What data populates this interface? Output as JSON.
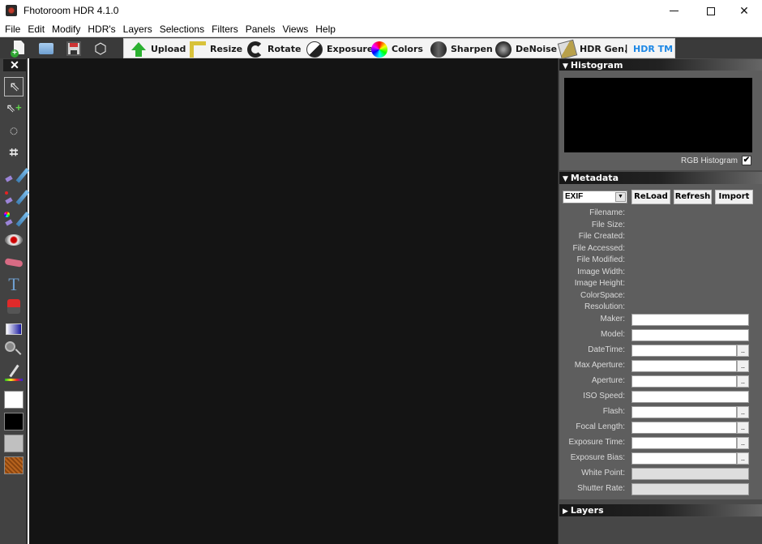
{
  "window": {
    "title": "Fhotoroom HDR 4.1.0",
    "controls": {
      "minimize": "–",
      "maximize": "☐",
      "close": "✕"
    }
  },
  "menu": {
    "items": [
      "File",
      "Edit",
      "Modify",
      "HDR's",
      "Layers",
      "Selections",
      "Filters",
      "Panels",
      "Views",
      "Help"
    ]
  },
  "toolbar": {
    "file_icons": [
      "new-file-icon",
      "open-folder-icon",
      "save-disk-icon",
      "3d-cube-icon"
    ],
    "actions": [
      {
        "label": "Upload",
        "icon": "upload-arrow-icon"
      },
      {
        "label": "Resize",
        "icon": "ruler-icon"
      },
      {
        "label": "Rotate",
        "icon": "rotate-icon"
      },
      {
        "label": "Exposure",
        "icon": "exposure-icon"
      },
      {
        "label": "Colors",
        "icon": "color-wheel-icon"
      },
      {
        "label": "Sharpen",
        "icon": "sharpen-icon"
      },
      {
        "label": "DeNoise",
        "icon": "denoise-icon"
      },
      {
        "label": "HDR Gen.",
        "icon": "hdr-gen-icon"
      }
    ],
    "separator": "|",
    "hdr_tm": "HDR TM",
    "hdr_tm_color": "#1e88e5"
  },
  "tools": {
    "close": "✕",
    "items": [
      {
        "name": "select-arrow",
        "glyph": "⇖",
        "active": true
      },
      {
        "name": "add-selection",
        "glyph": "⇖+"
      },
      {
        "name": "lasso",
        "glyph": "◌"
      },
      {
        "name": "crop",
        "glyph": "⌗"
      },
      {
        "name": "brush"
      },
      {
        "name": "red-brush"
      },
      {
        "name": "color-brush"
      },
      {
        "name": "red-eye"
      },
      {
        "name": "eraser"
      },
      {
        "name": "text",
        "glyph": "T"
      },
      {
        "name": "paint-bucket"
      },
      {
        "name": "gradient"
      },
      {
        "name": "magnifier"
      },
      {
        "name": "eyedropper"
      }
    ],
    "swatches": {
      "foreground": "#ffffff",
      "background": "#000000",
      "neutral": "#c0c0c0",
      "texture": "#b8641e"
    }
  },
  "histogram": {
    "header": "Histogram",
    "rgb_label": "RGB Histogram",
    "rgb_checked": true
  },
  "metadata": {
    "header": "Metadata",
    "type_select": "EXIF",
    "buttons": {
      "reload": "ReLoad",
      "refresh": "Refresh",
      "import": "Import"
    },
    "info_labels": [
      "Filename:",
      "File Size:",
      "File Created:",
      "File Accessed:",
      "File Modified:",
      "Image Width:",
      "Image Height:",
      "ColorSpace:",
      "Resolution:"
    ],
    "fields": [
      {
        "label": "Maker:",
        "value": "",
        "more": false,
        "disabled": false
      },
      {
        "label": "Model:",
        "value": "",
        "more": false,
        "disabled": false
      },
      {
        "label": "DateTime:",
        "value": "",
        "more": true,
        "disabled": false
      },
      {
        "label": "Max Aperture:",
        "value": "",
        "more": true,
        "disabled": false
      },
      {
        "label": "Aperture:",
        "value": "",
        "more": true,
        "disabled": false
      },
      {
        "label": "ISO Speed:",
        "value": "",
        "more": false,
        "disabled": false
      },
      {
        "label": "Flash:",
        "value": "",
        "more": true,
        "disabled": false
      },
      {
        "label": "Focal Length:",
        "value": "",
        "more": true,
        "disabled": false
      },
      {
        "label": "Exposure Time:",
        "value": "",
        "more": true,
        "disabled": false
      },
      {
        "label": "Exposure Bias:",
        "value": "",
        "more": true,
        "disabled": false
      },
      {
        "label": "White Point:",
        "value": "",
        "more": false,
        "disabled": true
      },
      {
        "label": "Shutter Rate:",
        "value": "",
        "more": false,
        "disabled": true
      }
    ],
    "more_label": ".."
  },
  "layers": {
    "header": "Layers",
    "expanded": false
  },
  "icons": {
    "expanded": "▼",
    "collapsed": "▶",
    "check": "✔"
  }
}
